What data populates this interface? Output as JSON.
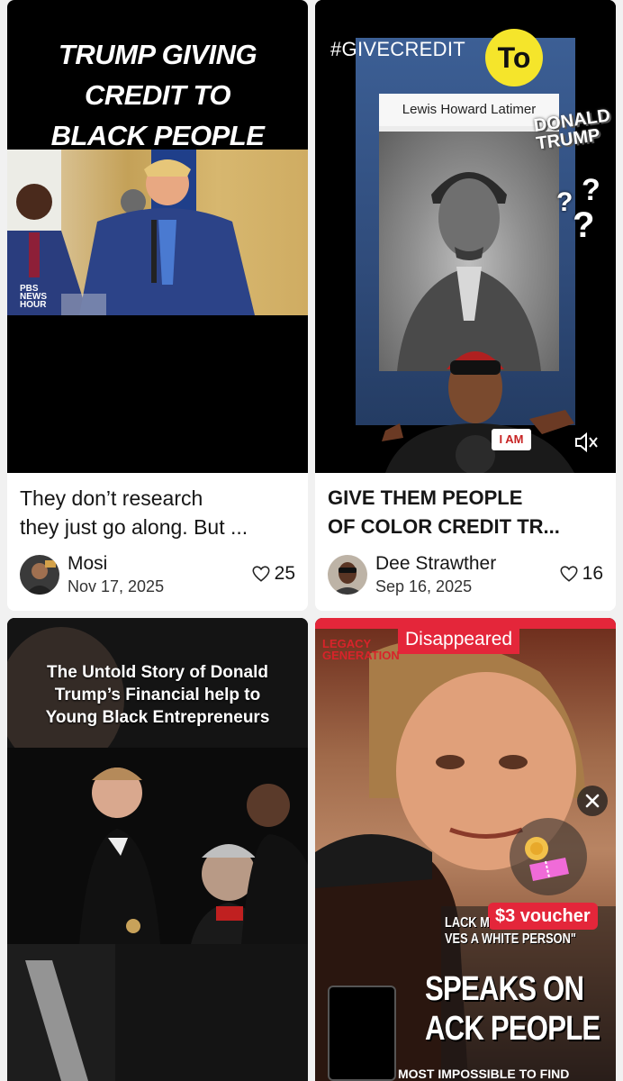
{
  "cards": [
    {
      "thumbnail": {
        "title_lines": [
          "TRUMP GIVING",
          "CREDIT TO",
          "BLACK PEOPLE"
        ],
        "network_lines": [
          "PBS",
          "NEWS",
          "HOUR"
        ]
      },
      "caption_lines": [
        "They don’t research",
        "they just go along. But ..."
      ],
      "author": "Mosi",
      "date": "Nov 17, 2025",
      "likes": "25"
    },
    {
      "thumbnail": {
        "hashtag": "#GIVECREDIT",
        "bubble": "To",
        "name_card": "Lewis Howard Latimer",
        "donald_lines": [
          "DONALD",
          "TRUMP"
        ],
        "badge": "I AM"
      },
      "caption_lines": [
        "GIVE THEM PEOPLE",
        "OF COLOR CREDIT TR..."
      ],
      "author": "Dee Strawther",
      "date": "Sep 16, 2025",
      "likes": "16"
    },
    {
      "thumbnail": {
        "headline_lines": [
          "The Untold Story of Donald",
          "Trump’s Financial help to",
          "Young Black Entrepreneurs"
        ]
      }
    },
    {
      "thumbnail": {
        "banner": "Disappeared",
        "logo_lines": [
          "LEGACY",
          "GENERATION"
        ],
        "voucher": "$3 voucher",
        "sub_lines": [
          "LACK M",
          "VES A WHITE PERSON\""
        ],
        "headline_lines": [
          "SPEAKS ON",
          "ACK PEOPLE"
        ],
        "bottom_text": "MOST IMPOSSIBLE TO FIND"
      }
    }
  ],
  "colors": {
    "accent_red": "#e4263a",
    "bubble_yellow": "#f5e52b",
    "background": "#f1f1f1"
  },
  "icons": {
    "like": "heart-outline-icon",
    "mute": "speaker-muted-icon",
    "close": "close-icon",
    "voucher": "voucher-gift-icon"
  }
}
